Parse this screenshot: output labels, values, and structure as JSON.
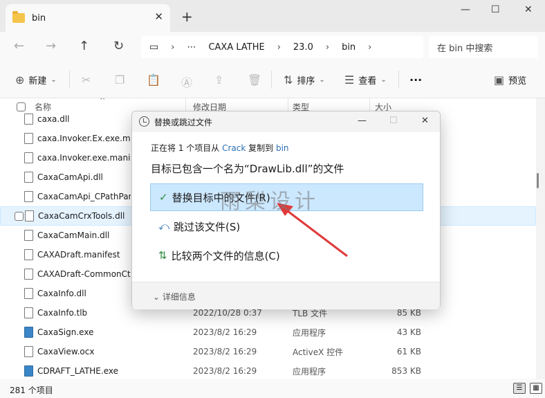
{
  "window": {
    "tab_title": "bin",
    "tab_close": "✕",
    "new_tab": "+",
    "minimize": "—",
    "maximize": "☐",
    "close": "✕"
  },
  "address": {
    "back": "←",
    "forward": "→",
    "up": "↑",
    "refresh": "↻",
    "crumbs": [
      "⋯",
      "CAXA LATHE",
      "23.0",
      "bin"
    ],
    "separator": "›",
    "search_placeholder": "在 bin 中搜索"
  },
  "toolbar": {
    "new_label": "新建",
    "sort_label": "排序",
    "view_label": "查看",
    "more": "···",
    "preview_label": "预览"
  },
  "columns": {
    "name": "名称",
    "date": "修改日期",
    "type": "类型",
    "size": "大小"
  },
  "files": [
    {
      "name": "caxa.dll",
      "date": "",
      "type": "",
      "size": ""
    },
    {
      "name": "caxa.Invoker.Ex.exe.manifest",
      "date": "",
      "type": "",
      "size": ""
    },
    {
      "name": "caxa.Invoker.exe.manifest",
      "date": "",
      "type": "",
      "size": ""
    },
    {
      "name": "CaxaCamApi.dll",
      "date": "",
      "type": "",
      "size": ""
    },
    {
      "name": "CaxaCamApi_CPathParam",
      "date": "",
      "type": "",
      "size": ""
    },
    {
      "name": "CaxaCamCrxTools.dll",
      "date": "",
      "type": "",
      "size": ""
    },
    {
      "name": "CaxaCamMain.dll",
      "date": "",
      "type": "",
      "size": ""
    },
    {
      "name": "CAXADraft.manifest",
      "date": "",
      "type": "",
      "size": ""
    },
    {
      "name": "CAXADraft-CommonCtrl",
      "date": "",
      "type": "",
      "size": ""
    },
    {
      "name": "CaxaInfo.dll",
      "date": "",
      "type": "",
      "size": ""
    },
    {
      "name": "CaxaInfo.tlb",
      "date": "2022/10/28 0:37",
      "type": "TLB 文件",
      "size": "85 KB"
    },
    {
      "name": "CaxaSign.exe",
      "date": "2023/8/2 16:29",
      "type": "应用程序",
      "size": "43 KB"
    },
    {
      "name": "CaxaView.ocx",
      "date": "2023/8/2 16:29",
      "type": "ActiveX 控件",
      "size": "61 KB"
    },
    {
      "name": "CDRAFT_LATHE.exe",
      "date": "2023/8/2 16:29",
      "type": "应用程序",
      "size": "853 KB"
    }
  ],
  "status": {
    "count": "281 个项目"
  },
  "dialog": {
    "title": "替换或跳过文件",
    "line1_prefix": "正在将 1 个项目从 ",
    "line1_source": "Crack",
    "line1_mid": " 复制到 ",
    "line1_dest": "bin",
    "line2": "目标已包含一个名为“DrawLib.dll”的文件",
    "options": [
      {
        "icon": "✓",
        "label": "替换目标中的文件(R)"
      },
      {
        "icon": "⤺",
        "label": "跳过该文件(S)"
      },
      {
        "icon": "⇅",
        "label": "比较两个文件的信息(C)"
      }
    ],
    "details_label": "详细信息",
    "details_icon": "⌄"
  },
  "watermark": "雨梨设计"
}
